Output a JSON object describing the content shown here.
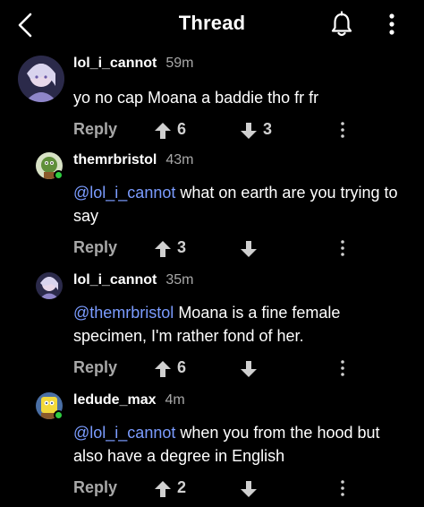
{
  "header": {
    "title": "Thread",
    "back_icon": "chevron-left-icon",
    "bell_icon": "bell-icon",
    "more_icon": "vertical-ellipsis-icon"
  },
  "colors": {
    "background": "#000000",
    "mention": "#7b9cff",
    "online": "#2ecc40",
    "muted": "#a8a8a8"
  },
  "comments": [
    {
      "username": "lol_i_cannot",
      "time": "59m",
      "mention": "",
      "text": "yo no cap Moana a baddie tho fr fr",
      "reply_label": "Reply",
      "upvotes": "6",
      "downvotes": "3",
      "avatar": "anime-girl-avatar"
    },
    {
      "username": "themrbristol",
      "time": "43m",
      "mention": "@lol_i_cannot",
      "text": " what on earth are you trying to say",
      "reply_label": "Reply",
      "upvotes": "3",
      "downvotes": "",
      "avatar": "green-character-avatar"
    },
    {
      "username": "lol_i_cannot",
      "time": "35m",
      "mention": "@themrbristol",
      "text": " Moana is a fine female specimen, I'm rather fond of her.",
      "reply_label": "Reply",
      "upvotes": "6",
      "downvotes": "",
      "avatar": "anime-girl-avatar"
    },
    {
      "username": "ledude_max",
      "time": "4m",
      "mention": "@lol_i_cannot",
      "text": " when you from the hood but also have a degree in English",
      "reply_label": "Reply",
      "upvotes": "2",
      "downvotes": "",
      "avatar": "yellow-character-avatar"
    }
  ]
}
